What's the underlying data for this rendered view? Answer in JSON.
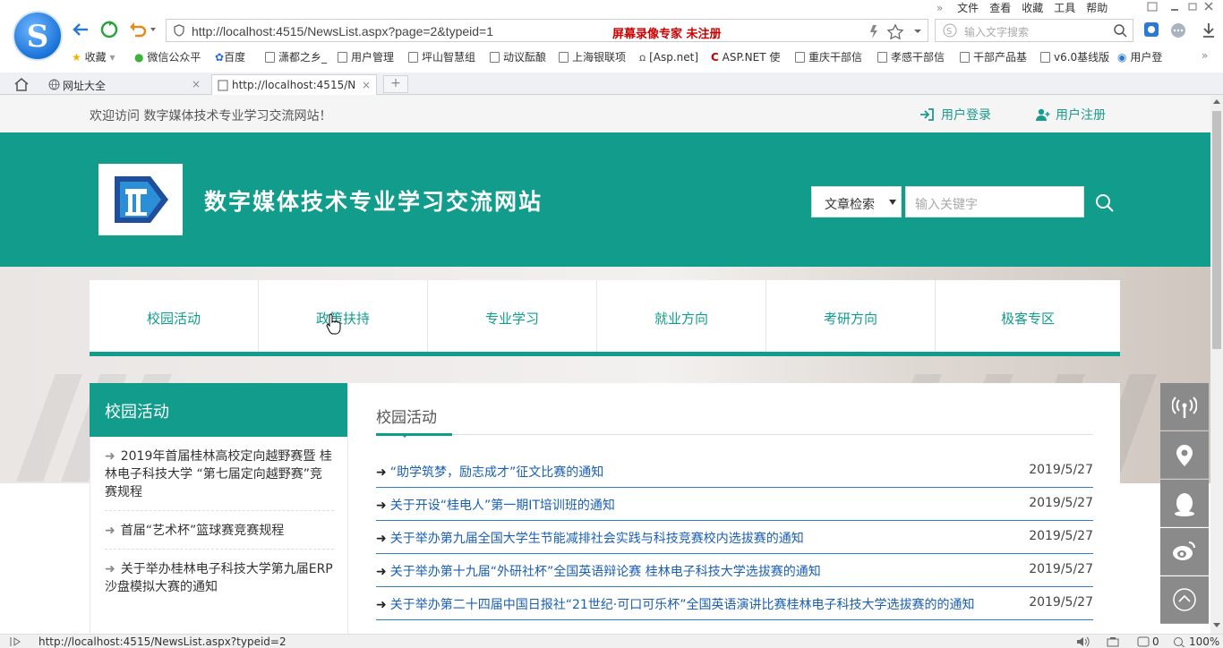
{
  "browser": {
    "menu": [
      "文件",
      "查看",
      "收藏",
      "工具",
      "帮助"
    ],
    "address_url": "http://localhost:4515/NewsList.aspx?page=2&typeid=1",
    "recorder_text": "屏幕录像专家  未注册",
    "search_placeholder": "输入文字搜索",
    "bookmarks": [
      "收藏",
      "微信公众平",
      "百度",
      "潇都之乡_",
      "用户管理",
      "坪山智慧组",
      "动议酝酿",
      "上海银联项",
      "[Asp.net]",
      "ASP.NET 使",
      "重庆干部信",
      "孝感干部信",
      "干部产品基",
      "v6.0基线版",
      "用户登"
    ],
    "tabs": [
      "网址大全",
      "http://localhost:4515/N"
    ],
    "status_url": "http://localhost:4515/NewsList.aspx?typeid=2",
    "status_count": "0",
    "zoom": "100%"
  },
  "site": {
    "welcome": "欢迎访问 数字媒体技术专业学习交流网站！",
    "login": "用户登录",
    "register": "用户注册",
    "title": "数字媒体技术专业学习交流网站",
    "search_select": "文章检索",
    "search_placeholder": "输入关键字",
    "nav": [
      "校园活动",
      "政策扶持",
      "专业学习",
      "就业方向",
      "考研方向",
      "极客专区"
    ],
    "sidebar_title": "校园活动",
    "sidebar_items": [
      "2019年首届桂林高校定向越野赛暨 桂林电子科技大学 “第七届定向越野赛”竞赛规程",
      "首届“艺术杯”篮球赛竞赛规程",
      "关于举办桂林电子科技大学第九届ERP沙盘模拟大赛的通知"
    ],
    "main_title": "校园活动",
    "news": [
      {
        "title": "“助学筑梦，励志成才”征文比赛的通知",
        "date": "2019/5/27"
      },
      {
        "title": "关于开设“桂电人”第一期IT培训班的通知",
        "date": "2019/5/27"
      },
      {
        "title": "关于举办第九届全国大学生节能减排社会实践与科技竞赛校内选拔赛的通知",
        "date": "2019/5/27"
      },
      {
        "title": "关于举办第十九届“外研社杯”全国英语辩论赛 桂林电子科技大学选拔赛的通知",
        "date": "2019/5/27"
      },
      {
        "title": "关于举办第二十四届中国日报社“21世纪·可口可乐杯”全国英语演讲比赛桂林电子科技大学选拔赛的的通知",
        "date": "2019/5/27"
      }
    ]
  },
  "colors": {
    "brand": "#119c8b",
    "link": "#1a5fb4"
  }
}
